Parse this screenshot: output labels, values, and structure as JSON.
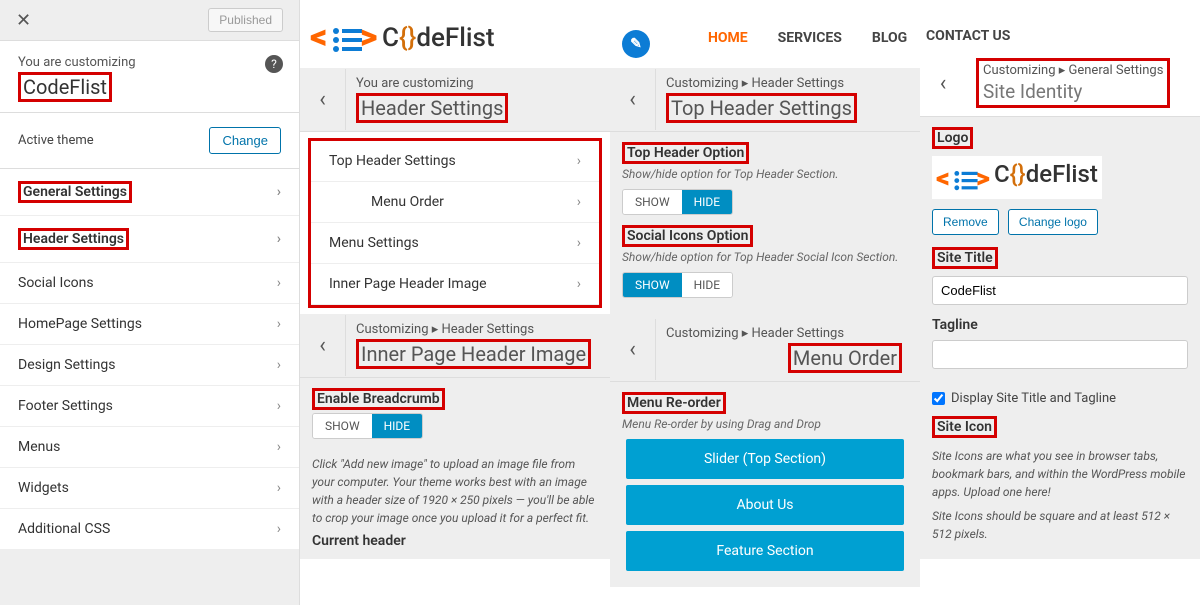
{
  "col1": {
    "published": "Published",
    "customizing_label": "You are customizing",
    "site_name": "CodeFlist",
    "active_theme_label": "Active theme",
    "change": "Change",
    "items": [
      "General Settings",
      "Header Settings",
      "Social Icons",
      "HomePage Settings",
      "Design Settings",
      "Footer Settings",
      "Menus",
      "Widgets",
      "Additional CSS"
    ]
  },
  "logo_word_pre": "C",
  "logo_word_brace": "{}",
  "logo_word_post": "deFlist",
  "nav": {
    "home": "HOME",
    "services": "SERVICES",
    "blog": "BLOG",
    "contact": "CONTACT US"
  },
  "col2": {
    "customizing_label": "You are customizing",
    "title": "Header Settings",
    "items": [
      "Top Header Settings",
      "Menu Order",
      "Menu Settings",
      "Inner Page Header Image"
    ],
    "crumb2_path": "Customizing ▸ Header Settings",
    "crumb2_title": "Inner Page Header Image",
    "breadcrumb_label": "Enable Breadcrumb",
    "show": "SHOW",
    "hide": "HIDE",
    "breadcrumb_help": "Click \"Add new image\" to upload an image file from your computer. Your theme works best with an image with a header size of 1920 × 250 pixels — you'll be able to crop your image once you upload it for a perfect fit.",
    "current_header": "Current header"
  },
  "col3": {
    "crumb_path": "Customizing ▸ Header Settings",
    "crumb_title": "Top Header Settings",
    "opt1_label": "Top Header Option",
    "opt1_desc": "Show/hide option for Top Header Section.",
    "opt2_label": "Social Icons Option",
    "opt2_desc": "Show/hide option for Top Header Social Icon Section.",
    "show": "SHOW",
    "hide": "HIDE",
    "crumb2_path": "Customizing ▸ Header Settings",
    "crumb2_title": "Menu Order",
    "reorder_label": "Menu Re-order",
    "reorder_desc": "Menu Re-order by using Drag and Drop",
    "reorder_items": [
      "Slider (Top Section)",
      "About Us",
      "Feature Section"
    ]
  },
  "col4": {
    "crumb_path": "Customizing ▸ General Settings",
    "crumb_title": "Site Identity",
    "logo_label": "Logo",
    "remove": "Remove",
    "change_logo": "Change logo",
    "site_title_label": "Site Title",
    "site_title_value": "CodeFlist",
    "tagline_label": "Tagline",
    "display_check": "Display Site Title and Tagline",
    "site_icon_label": "Site Icon",
    "icon_help1": "Site Icons are what you see in browser tabs, bookmark bars, and within the WordPress mobile apps. Upload one here!",
    "icon_help2": "Site Icons should be square and at least 512 × 512 pixels."
  }
}
